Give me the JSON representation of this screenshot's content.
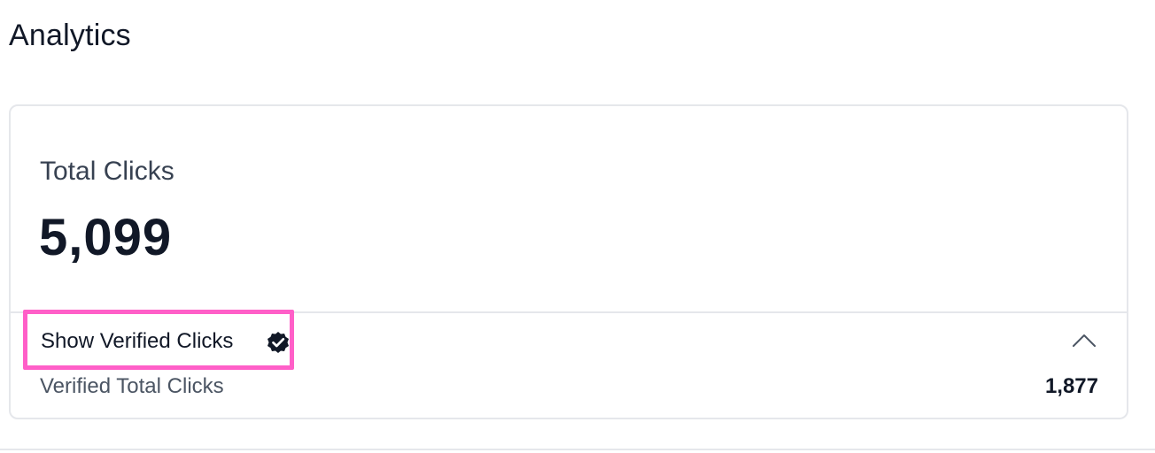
{
  "page": {
    "title": "Analytics"
  },
  "metric_card": {
    "label": "Total Clicks",
    "value": "5,099"
  },
  "verified_section": {
    "toggle_label": "Show Verified Clicks",
    "toggle_icon": "verified-check-icon",
    "expand_icon": "chevron-up-icon",
    "total_label": "Verified Total Clicks",
    "total_value": "1,877"
  },
  "colors": {
    "highlight": "#ff5fc8",
    "text_primary": "#111827",
    "border": "#e5e7eb"
  }
}
